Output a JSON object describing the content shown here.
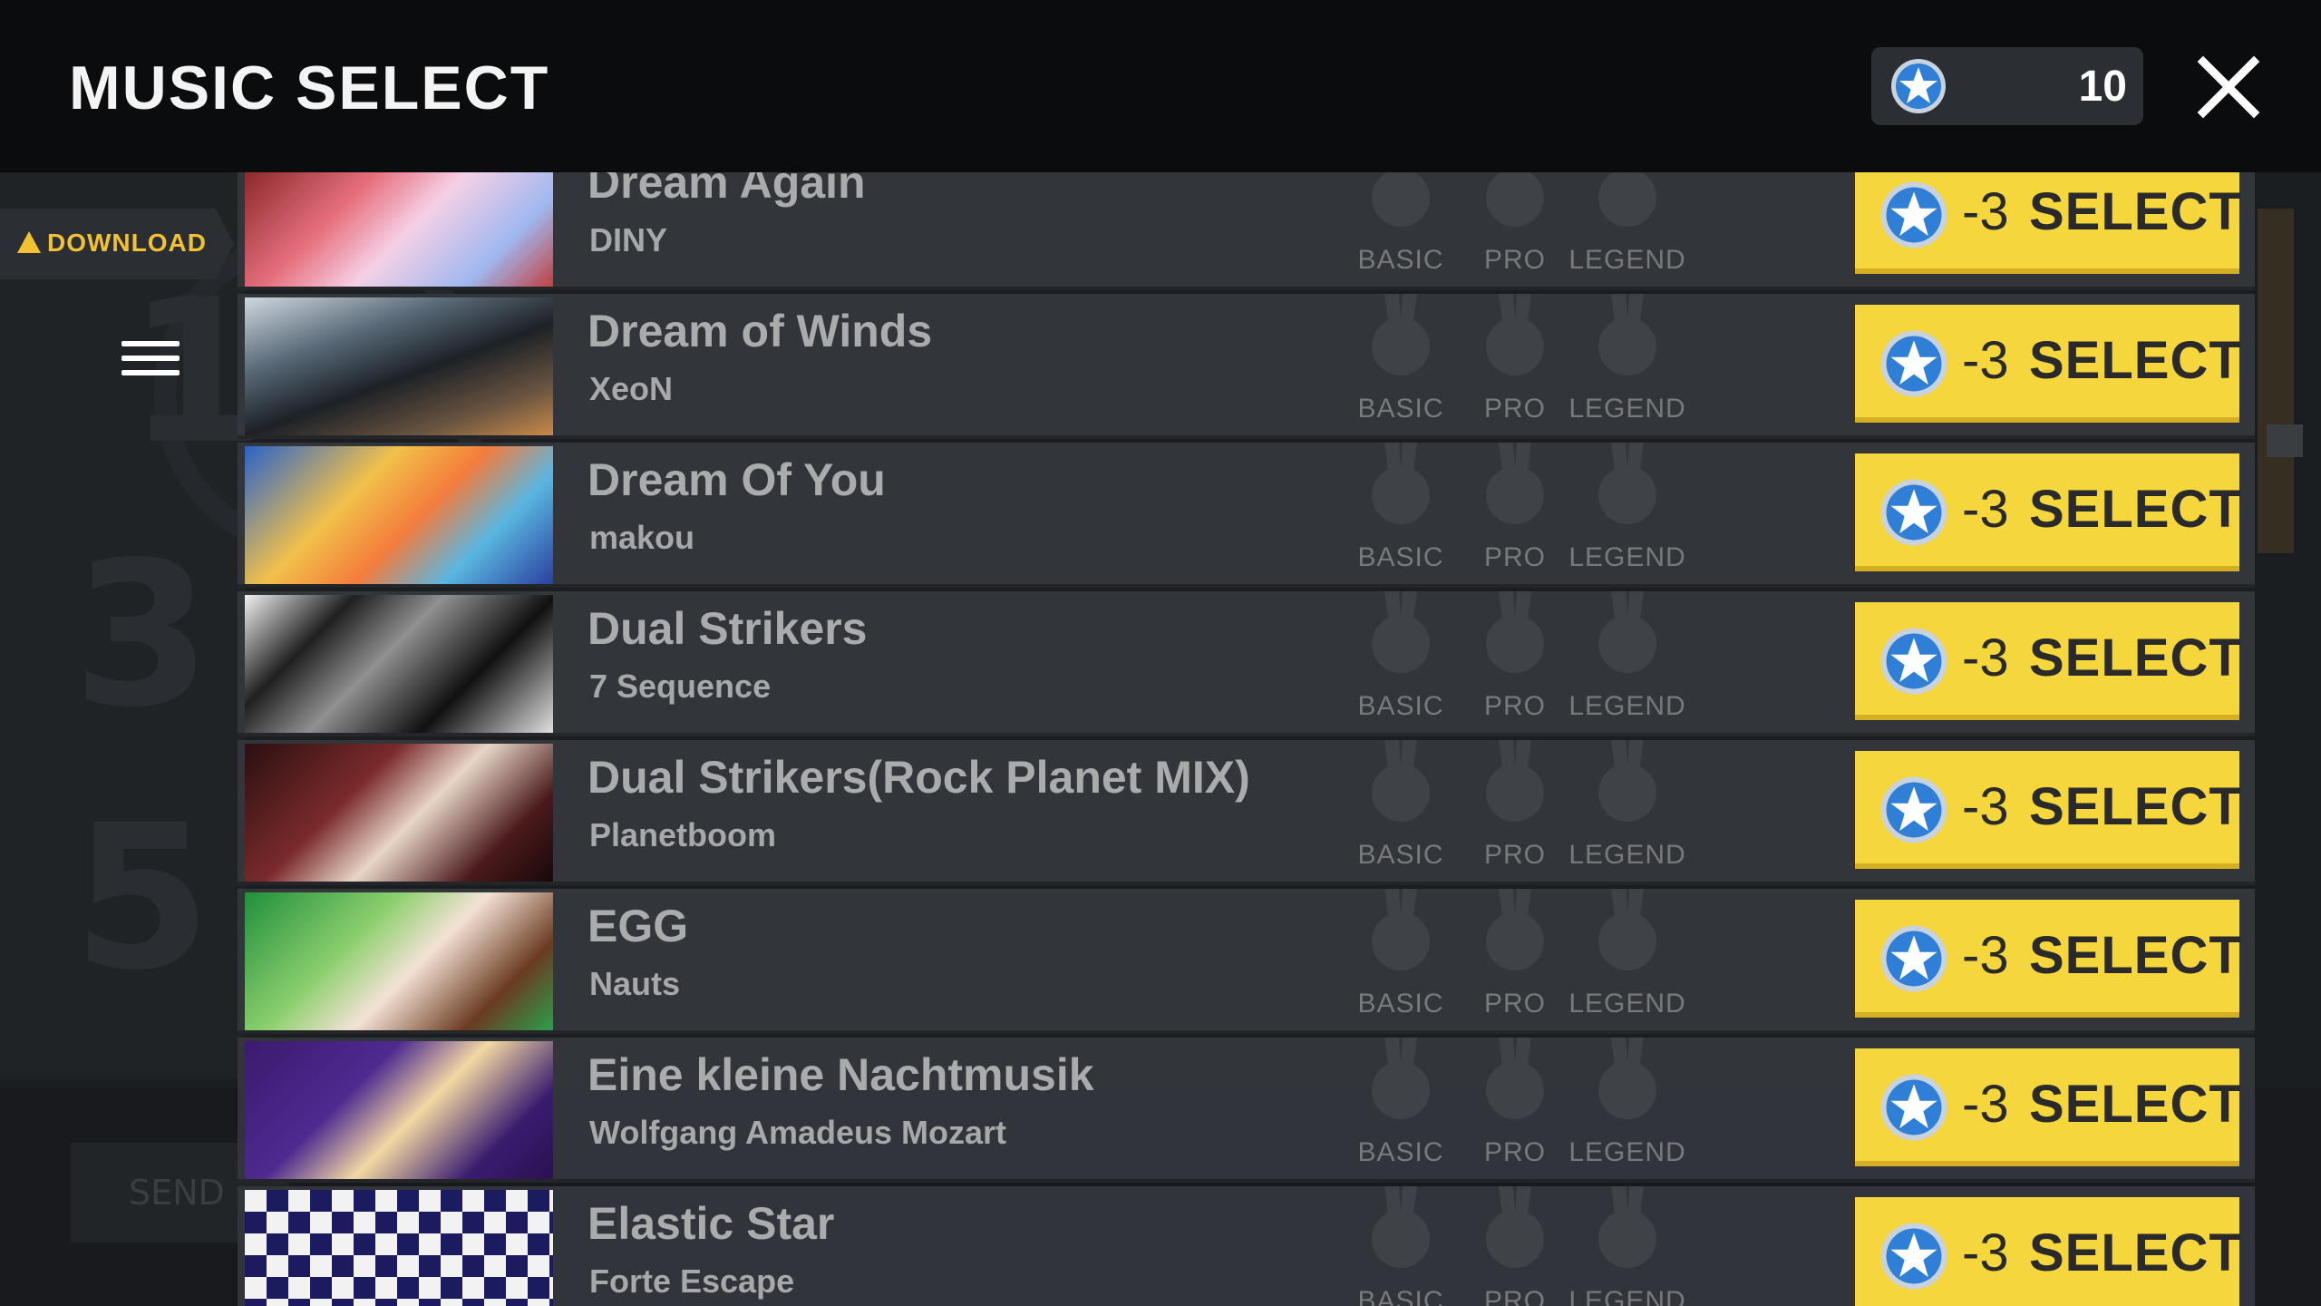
{
  "header": {
    "title": "MUSIC SELECT",
    "credits": "10"
  },
  "sidebar": {
    "download_label": "DOWNLOAD"
  },
  "background": {
    "digits": [
      "1",
      "3",
      "5"
    ],
    "send_label": "SEND"
  },
  "difficulty_labels": [
    "BASIC",
    "PRO",
    "LEGEND"
  ],
  "select_button": {
    "cost": "-3",
    "label": "SELECT"
  },
  "songs": [
    {
      "title": "Dream Again",
      "artist": "DINY"
    },
    {
      "title": "Dream of Winds",
      "artist": "XeoN"
    },
    {
      "title": "Dream Of You",
      "artist": "makou"
    },
    {
      "title": "Dual Strikers",
      "artist": "7 Sequence"
    },
    {
      "title": "Dual Strikers(Rock Planet MIX)",
      "artist": "Planetboom"
    },
    {
      "title": "EGG",
      "artist": "Nauts"
    },
    {
      "title": "Eine kleine Nachtmusik",
      "artist": "Wolfgang Amadeus Mozart"
    },
    {
      "title": "Elastic Star",
      "artist": "Forte Escape"
    }
  ],
  "colors": {
    "accent_button": "#f6d63d",
    "download_text": "#f3c232",
    "coin_blue": "#2f7fd6"
  }
}
